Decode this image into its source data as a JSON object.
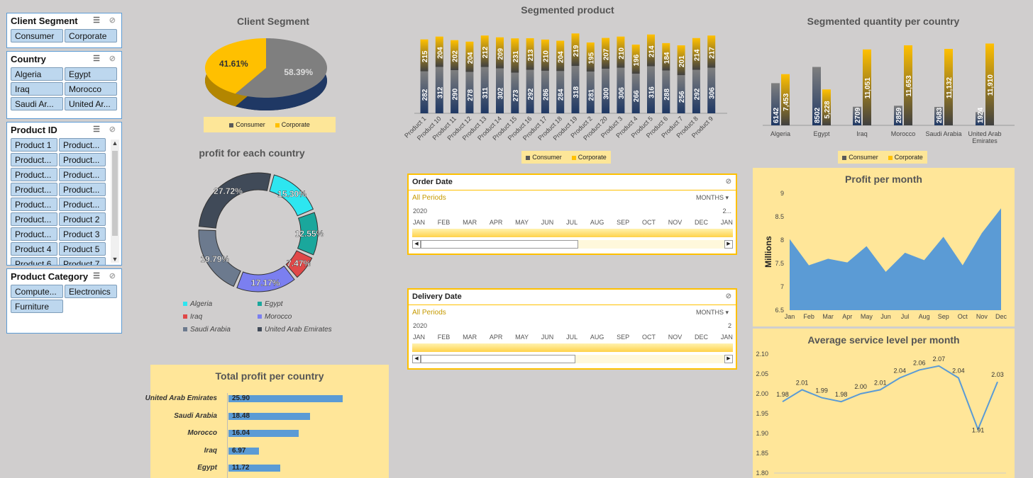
{
  "slicers": {
    "client_segment": {
      "title": "Client Segment",
      "items": [
        "Consumer",
        "Corporate"
      ]
    },
    "country": {
      "title": "Country",
      "items": [
        "Algeria",
        "Egypt",
        "Iraq",
        "Morocco",
        "Saudi Ar...",
        "United Ar..."
      ]
    },
    "product_id": {
      "title": "Product ID",
      "items": [
        "Product 1",
        "Product...",
        "Product...",
        "Product...",
        "Product...",
        "Product...",
        "Product...",
        "Product...",
        "Product...",
        "Product...",
        "Product...",
        "Product 2",
        "Product...",
        "Product 3",
        "Product 4",
        "Product 5",
        "Product 6",
        "Product 7"
      ]
    },
    "product_category": {
      "title": "Product Category",
      "items": [
        "Compute...",
        "Electronics",
        "Furniture"
      ]
    }
  },
  "timelines": {
    "order": {
      "title": "Order Date",
      "periods": "All Periods",
      "unit": "MONTHS",
      "year": "2020",
      "year_end": "2...",
      "months": [
        "JAN",
        "FEB",
        "MAR",
        "APR",
        "MAY",
        "JUN",
        "JUL",
        "AUG",
        "SEP",
        "OCT",
        "NOV",
        "DEC",
        "JAN"
      ]
    },
    "delivery": {
      "title": "Delivery Date",
      "periods": "All Periods",
      "unit": "MONTHS",
      "year": "2020",
      "year_end": "2",
      "months": [
        "JAN",
        "FEB",
        "MAR",
        "APR",
        "MAY",
        "JUN",
        "JUL",
        "AUG",
        "SEP",
        "OCT",
        "NOV",
        "DEC",
        "JAN"
      ]
    }
  },
  "colors": {
    "consumer": "#7f7f7f",
    "corporate": "#ffc000",
    "navy": "#1f3864",
    "line": "#5b9bd5"
  },
  "chart_data": [
    {
      "id": "client_segment",
      "type": "pie",
      "title": "Client Segment",
      "labels": [
        "Consumer",
        "Corporate"
      ],
      "values": [
        58.39,
        41.61
      ],
      "value_labels": [
        "58.39%",
        "41.61%"
      ],
      "legend": [
        "Consumer",
        "Corporate"
      ]
    },
    {
      "id": "segmented_product",
      "type": "bar",
      "stacked": true,
      "title": "Segmented product",
      "categories": [
        "Product 1",
        "Product 10",
        "Product 11",
        "Product 12",
        "Product 13",
        "Product 14",
        "Product 15",
        "Product 16",
        "Product 17",
        "Product 18",
        "Product 19",
        "Product 2",
        "Product 20",
        "Product 3",
        "Product 4",
        "Product 5",
        "Product 6",
        "Product 7",
        "Product 8",
        "Product 9"
      ],
      "series": [
        {
          "name": "Consumer",
          "values": [
            282,
            312,
            290,
            278,
            311,
            302,
            273,
            292,
            286,
            284,
            318,
            281,
            300,
            306,
            266,
            316,
            288,
            256,
            292,
            306
          ]
        },
        {
          "name": "Corporate",
          "values": [
            215,
            204,
            202,
            204,
            212,
            209,
            231,
            213,
            210,
            204,
            219,
            195,
            207,
            210,
            196,
            214,
            184,
            201,
            214,
            217
          ]
        }
      ],
      "legend": [
        "Consumer",
        "Corporate"
      ]
    },
    {
      "id": "segmented_quantity",
      "type": "bar",
      "title": "Segmented quantity per country",
      "categories": [
        "Algeria",
        "Egypt",
        "Iraq",
        "Morocco",
        "Saudi Arabia",
        "United Arab Emirates"
      ],
      "series": [
        {
          "name": "Consumer",
          "values": [
            6142,
            8502,
            2709,
            2859,
            2683,
            1924
          ],
          "labels": [
            "6142",
            "8502",
            "2709",
            "2859",
            "2683",
            "1924"
          ]
        },
        {
          "name": "Corporate",
          "values": [
            7453,
            5228,
            11051,
            11653,
            11132,
            11910
          ],
          "labels": [
            "7,453",
            "5,228",
            "11,051",
            "11,653",
            "11,132",
            "11,910"
          ]
        }
      ],
      "legend": [
        "Consumer",
        "Corporate"
      ]
    },
    {
      "id": "profit_country_donut",
      "type": "pie",
      "title": "profit for each country",
      "labels": [
        "Algeria",
        "Egypt",
        "Iraq",
        "Morocco",
        "Saudi Arabia",
        "United Arab Emirates"
      ],
      "values": [
        15.3,
        12.55,
        7.47,
        17.17,
        19.79,
        27.72
      ],
      "value_labels": [
        "15.30%",
        "12.55%",
        "7.47%",
        "17.17%",
        "19.79%",
        "27.72%"
      ],
      "colors": [
        "#2de6f0",
        "#1aa79c",
        "#e04848",
        "#7b7ff0",
        "#6c7a8e",
        "#404a58"
      ]
    },
    {
      "id": "total_profit_country",
      "type": "bar",
      "orientation": "horizontal",
      "title": "Total profit per country",
      "categories": [
        "United Arab Emirates",
        "Saudi Arabia",
        "Morocco",
        "Iraq",
        "Egypt"
      ],
      "values": [
        25.9,
        18.48,
        16.04,
        6.97,
        11.72
      ],
      "value_labels": [
        "25.90",
        "18.48",
        "16.04",
        "6.97",
        "11.72"
      ]
    },
    {
      "id": "profit_month",
      "type": "area",
      "title": "Profit per month",
      "ylabel": "Millions",
      "categories": [
        "Jan",
        "Feb",
        "Mar",
        "Apr",
        "May",
        "Jun",
        "Jul",
        "Aug",
        "Sep",
        "Oct",
        "Nov",
        "Dec"
      ],
      "values": [
        8.02,
        7.46,
        7.6,
        7.52,
        7.87,
        7.32,
        7.73,
        7.57,
        8.07,
        7.46,
        8.15,
        8.68
      ],
      "ylim": [
        6.5,
        9
      ],
      "yticks": [
        "6.5",
        "7",
        "7.5",
        "8",
        "8.5",
        "9"
      ]
    },
    {
      "id": "service_level",
      "type": "line",
      "title": "Average service level per month",
      "categories": [
        "Jan",
        "Feb",
        "Mar",
        "Apr",
        "May",
        "Jun",
        "Jul",
        "Aug",
        "Sep",
        "Oct",
        "Nov",
        "Dec"
      ],
      "values": [
        1.98,
        2.01,
        1.99,
        1.98,
        2.0,
        2.01,
        2.04,
        2.06,
        2.07,
        2.04,
        1.91,
        2.03
      ],
      "value_labels": [
        "1.98",
        "2.01",
        "1.99",
        "1.98",
        "2.00",
        "2.01",
        "2.04",
        "2.06",
        "2.07",
        "2.04",
        "1.91",
        "2.03"
      ],
      "ylim": [
        1.8,
        2.1
      ],
      "yticks": [
        "1.80",
        "1.85",
        "1.90",
        "1.95",
        "2.00",
        "2.05",
        "2.10"
      ]
    }
  ]
}
